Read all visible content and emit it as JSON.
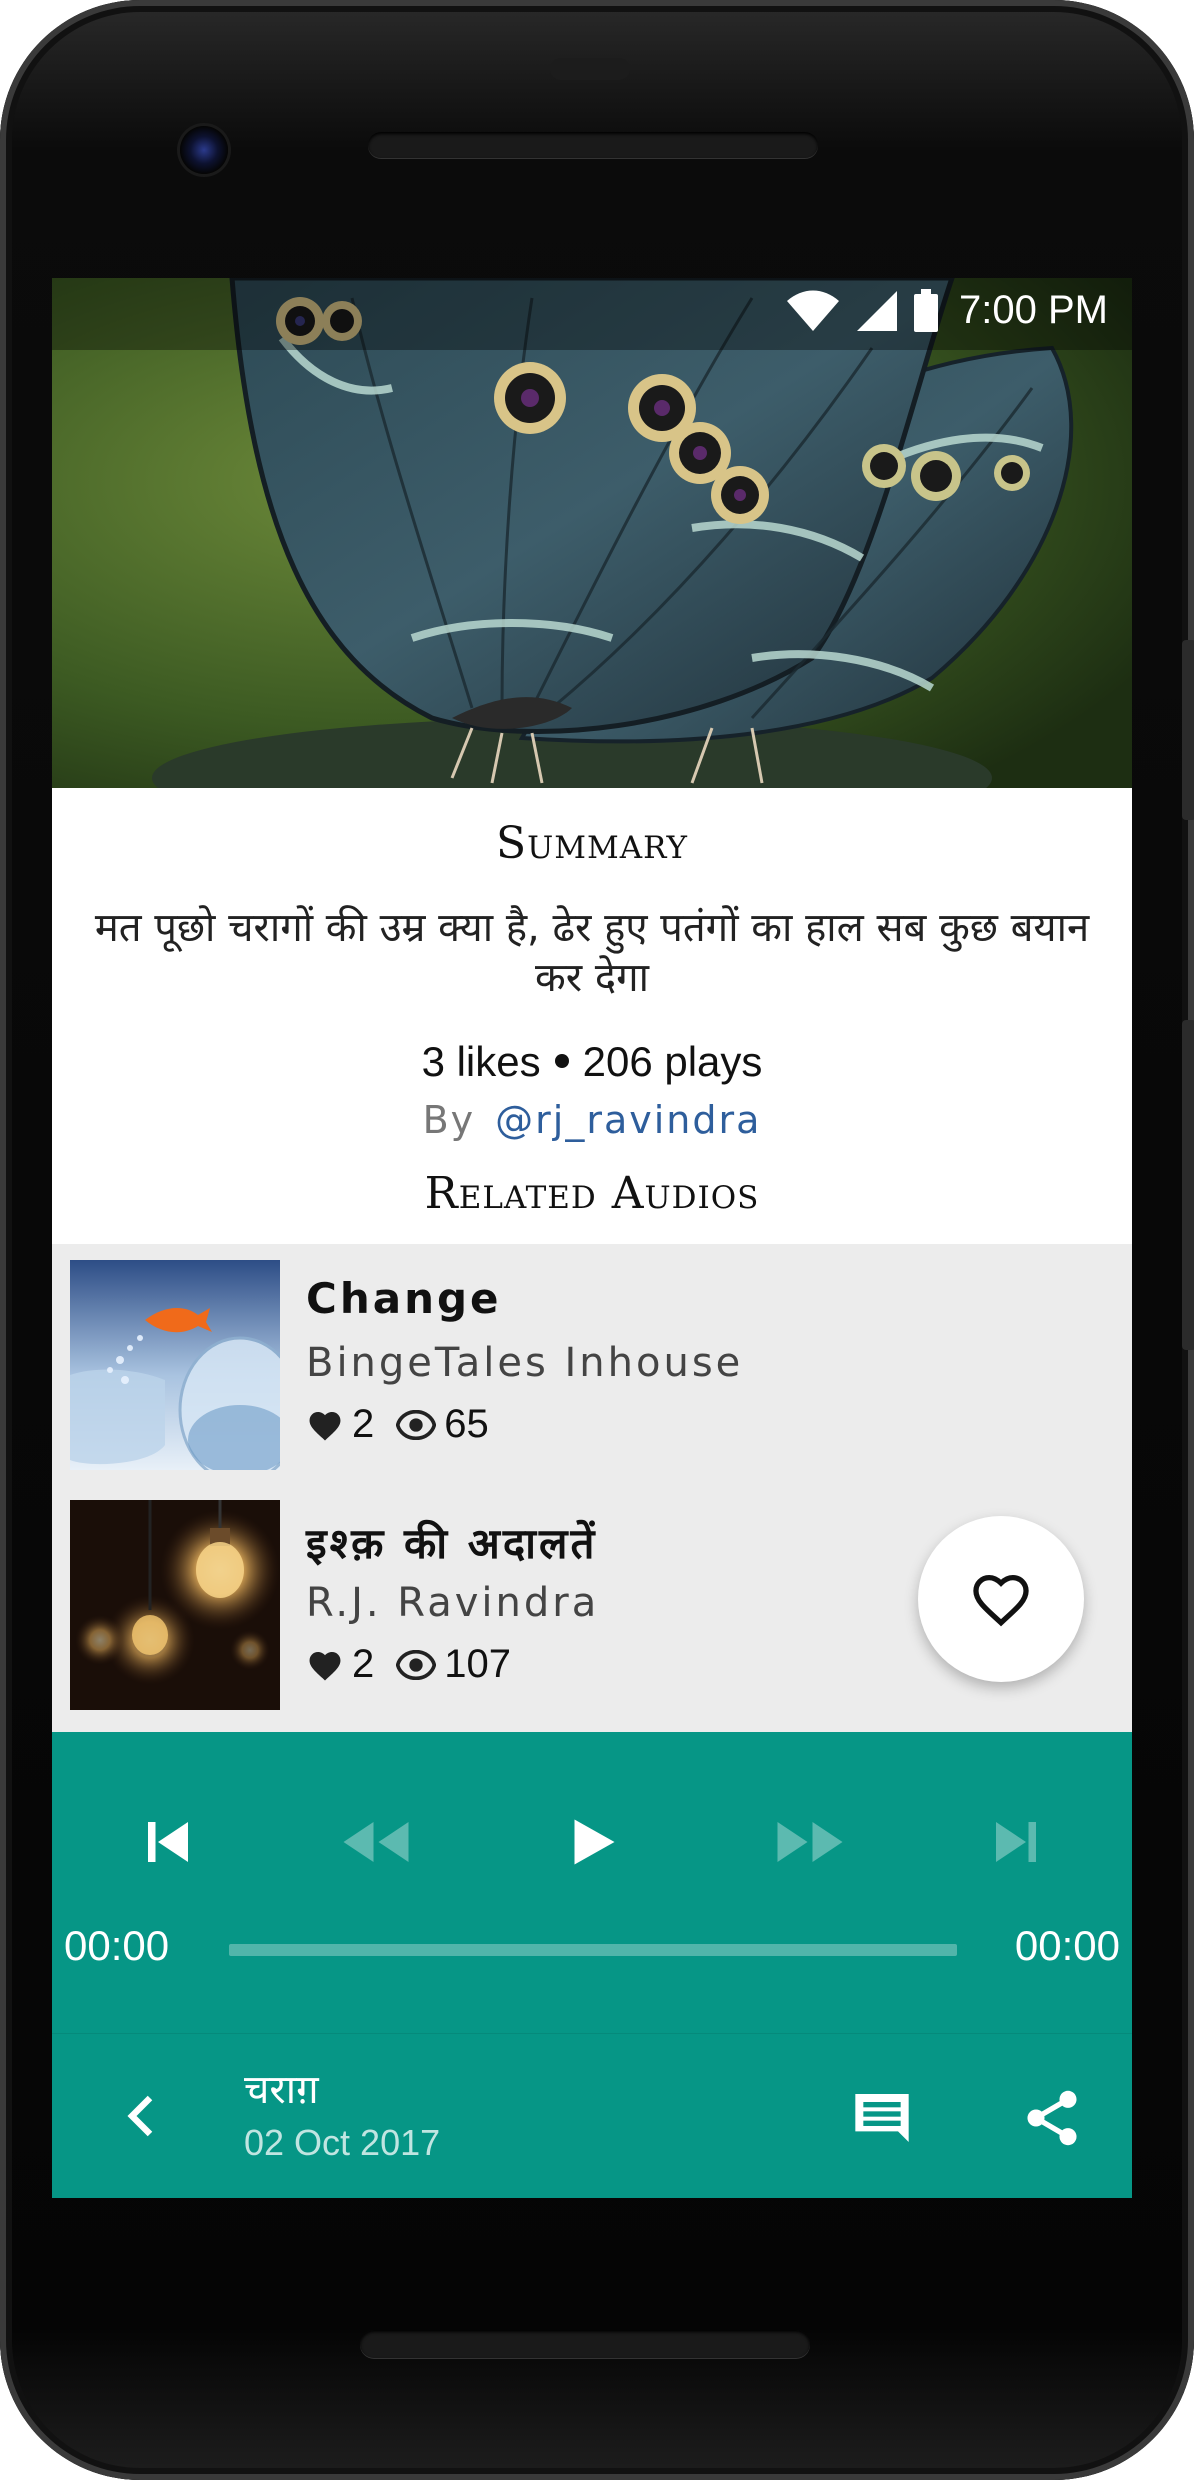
{
  "status_bar": {
    "time": "7:00 PM"
  },
  "summary": {
    "heading": "Summary",
    "text": "मत पूछो चरागों की उम्र क्या है, ढेर हुए पतंगों का हाल सब कुछ बयान कर देगा",
    "likes": "3 likes",
    "plays": "206 plays",
    "by_label": "By",
    "author": "@rj_ravindra"
  },
  "related": {
    "heading": "Related Audios",
    "items": [
      {
        "title": "Change",
        "author": "BingeTales Inhouse",
        "likes": "2",
        "views": "65"
      },
      {
        "title": "इश्क़ की अदालतें",
        "author": "R.J. Ravindra",
        "likes": "2",
        "views": "107"
      }
    ]
  },
  "player": {
    "elapsed": "00:00",
    "duration": "00:00",
    "progress": 0
  },
  "now_playing": {
    "title": "चराग़",
    "date": "02 Oct 2017"
  },
  "colors": {
    "accent": "#069686",
    "link": "#2e5e9c",
    "list_bg": "#ececec"
  },
  "icons": [
    "wifi-icon",
    "signal-icon",
    "battery-icon",
    "heart-icon",
    "eye-icon",
    "skip-previous-icon",
    "rewind-icon",
    "play-icon",
    "fast-forward-icon",
    "skip-next-icon",
    "back-icon",
    "comment-icon",
    "share-icon"
  ]
}
